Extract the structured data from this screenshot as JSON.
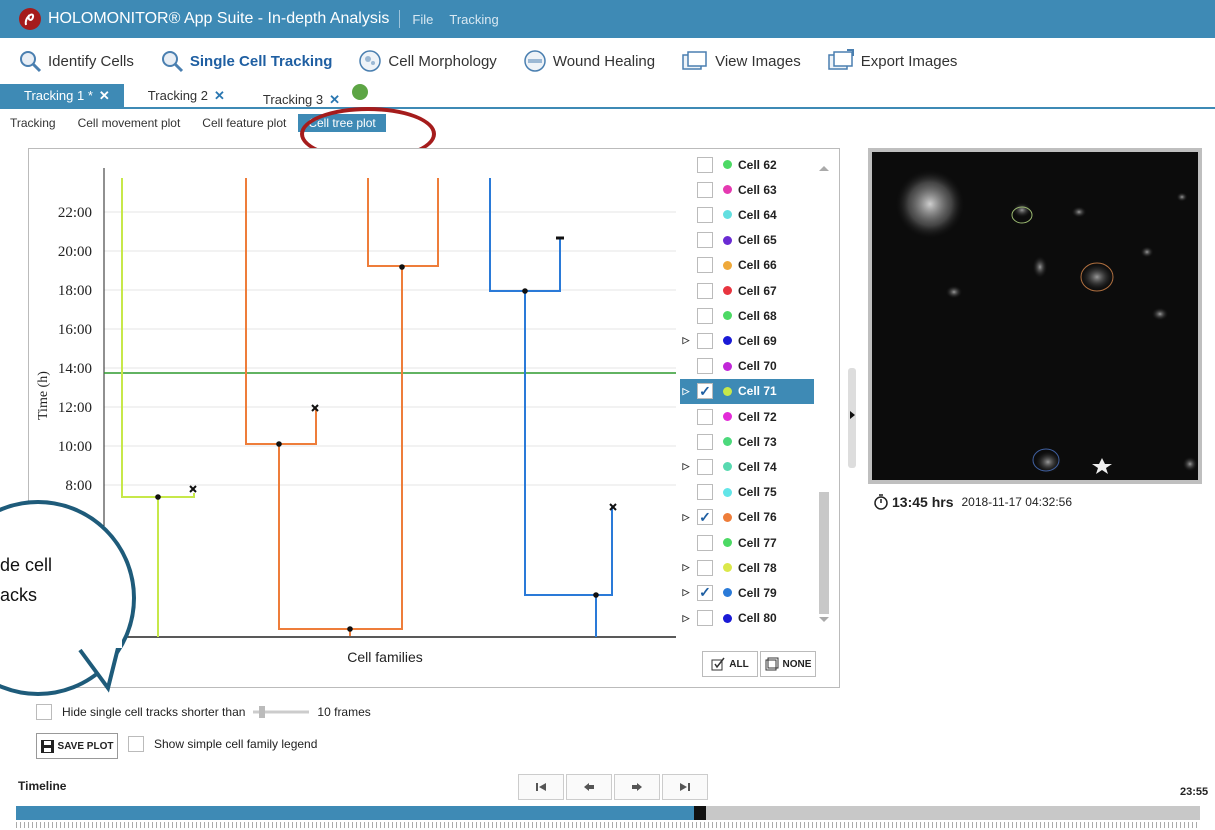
{
  "window": {
    "title": "HOLOMONITOR® App Suite - In-depth Analysis",
    "menu": [
      "File",
      "Tracking"
    ]
  },
  "toolbar": {
    "items": [
      {
        "label": "Identify Cells",
        "icon": "identify-cells-icon"
      },
      {
        "label": "Single Cell Tracking",
        "icon": "single-cell-tracking-icon",
        "active": true
      },
      {
        "label": "Cell Morphology",
        "icon": "cell-morphology-icon"
      },
      {
        "label": "Wound Healing",
        "icon": "wound-healing-icon"
      },
      {
        "label": "View Images",
        "icon": "view-images-icon"
      },
      {
        "label": "Export Images",
        "icon": "export-images-icon"
      }
    ]
  },
  "tabs": [
    {
      "label": "Tracking 1 *",
      "close": "✕",
      "active": true
    },
    {
      "label": "Tracking 2",
      "close": "✕"
    },
    {
      "label": "Tracking 3",
      "close": "✕"
    }
  ],
  "subtabs": [
    "Tracking",
    "Cell movement plot",
    "Cell feature plot",
    "Cell tree plot"
  ],
  "plot": {
    "ylabel": "Time (h)",
    "xlabel": "Cell families",
    "yticks": [
      "22:00",
      "20:00",
      "18:00",
      "16:00",
      "14:00",
      "12:00",
      "10:00",
      "8:00"
    ],
    "current_time_line": "13:45"
  },
  "cells": [
    {
      "label": "Cell 62",
      "color": "#4cd964",
      "checked": false,
      "expandable": false
    },
    {
      "label": "Cell 63",
      "color": "#e53ab1",
      "checked": false,
      "expandable": false
    },
    {
      "label": "Cell 64",
      "color": "#62dfe0",
      "checked": false,
      "expandable": false
    },
    {
      "label": "Cell 65",
      "color": "#6a2bd3",
      "checked": false,
      "expandable": false
    },
    {
      "label": "Cell 66",
      "color": "#efa93a",
      "checked": false,
      "expandable": false
    },
    {
      "label": "Cell 67",
      "color": "#e8343f",
      "checked": false,
      "expandable": false
    },
    {
      "label": "Cell 68",
      "color": "#4cd964",
      "checked": false,
      "expandable": false
    },
    {
      "label": "Cell 69",
      "color": "#1a1ad6",
      "checked": false,
      "expandable": true
    },
    {
      "label": "Cell 70",
      "color": "#c127d8",
      "checked": false,
      "expandable": false
    },
    {
      "label": "Cell 71",
      "color": "#c7e84a",
      "checked": true,
      "expandable": true,
      "selected": true
    },
    {
      "label": "Cell 72",
      "color": "#e32bd8",
      "checked": false,
      "expandable": false
    },
    {
      "label": "Cell 73",
      "color": "#4cd97c",
      "checked": false,
      "expandable": false
    },
    {
      "label": "Cell 74",
      "color": "#58d9b0",
      "checked": false,
      "expandable": true
    },
    {
      "label": "Cell 75",
      "color": "#62e5e8",
      "checked": false,
      "expandable": false
    },
    {
      "label": "Cell 76",
      "color": "#ee7d3a",
      "checked": true,
      "expandable": true
    },
    {
      "label": "Cell 77",
      "color": "#4cd964",
      "checked": false,
      "expandable": false
    },
    {
      "label": "Cell 78",
      "color": "#dbe84a",
      "checked": false,
      "expandable": true
    },
    {
      "label": "Cell 79",
      "color": "#2a7ad8",
      "checked": true,
      "expandable": true
    },
    {
      "label": "Cell 80",
      "color": "#1a1ad6",
      "checked": false,
      "expandable": true
    }
  ],
  "select_buttons": {
    "all": "ALL",
    "none": "NONE"
  },
  "image": {
    "time": "13:45 hrs",
    "timestamp": "2018-11-17 04:32:56"
  },
  "callout": {
    "lines": [
      "de cell",
      "acks"
    ]
  },
  "controls": {
    "hide_short": "Hide single cell tracks shorter than",
    "frames": "10 frames",
    "save_plot": "SAVE PLOT",
    "simple_legend": "Show simple cell family legend"
  },
  "timeline": {
    "label": "Timeline",
    "end_time": "23:55",
    "progress": 0.573
  },
  "colors": {
    "accent": "#3e8ab5",
    "lime": "#c7e84a",
    "orange": "#ee7d3a",
    "blue": "#2a7ad8",
    "green_line": "#2e9a2e",
    "red_ring": "#a51c1c"
  }
}
